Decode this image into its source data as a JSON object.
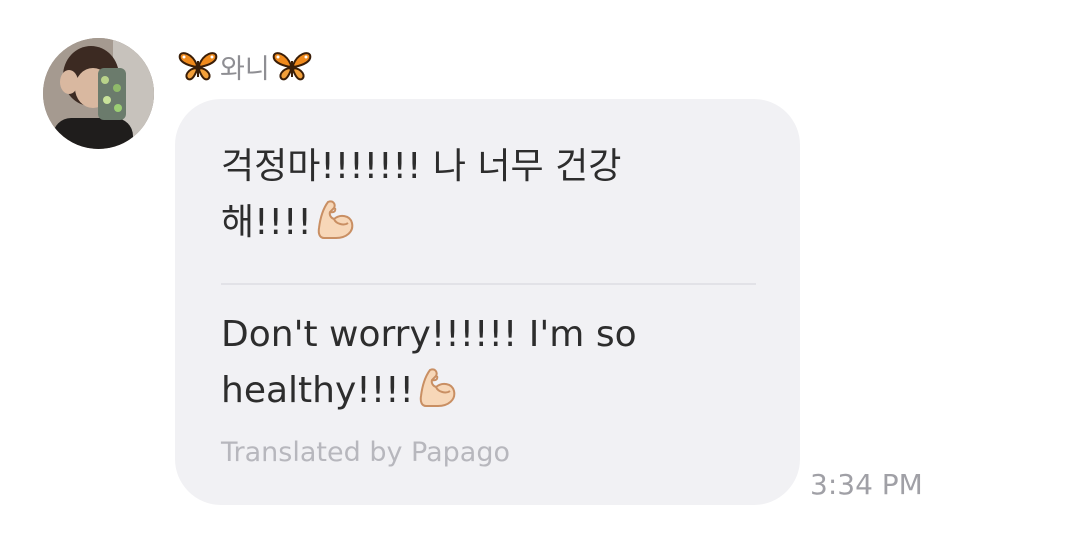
{
  "sender": {
    "name": "와니",
    "decoration_icon": "butterfly-icon"
  },
  "message": {
    "original_line1": "걱정마!!!!!!! 나 너무 건강",
    "original_line2": "해!!!!",
    "translated_line1": "Don't worry!!!!!! I'm so",
    "translated_line2": "healthy!!!!",
    "emoji": "flexed-biceps-icon",
    "translation_credit": "Translated by Papago",
    "time": "3:34 PM"
  },
  "colors": {
    "bubble_background": "#f1f1f4",
    "message_text": "#2d2d2d",
    "secondary_text": "#8e8e93",
    "divider": "#e2e2e7"
  }
}
